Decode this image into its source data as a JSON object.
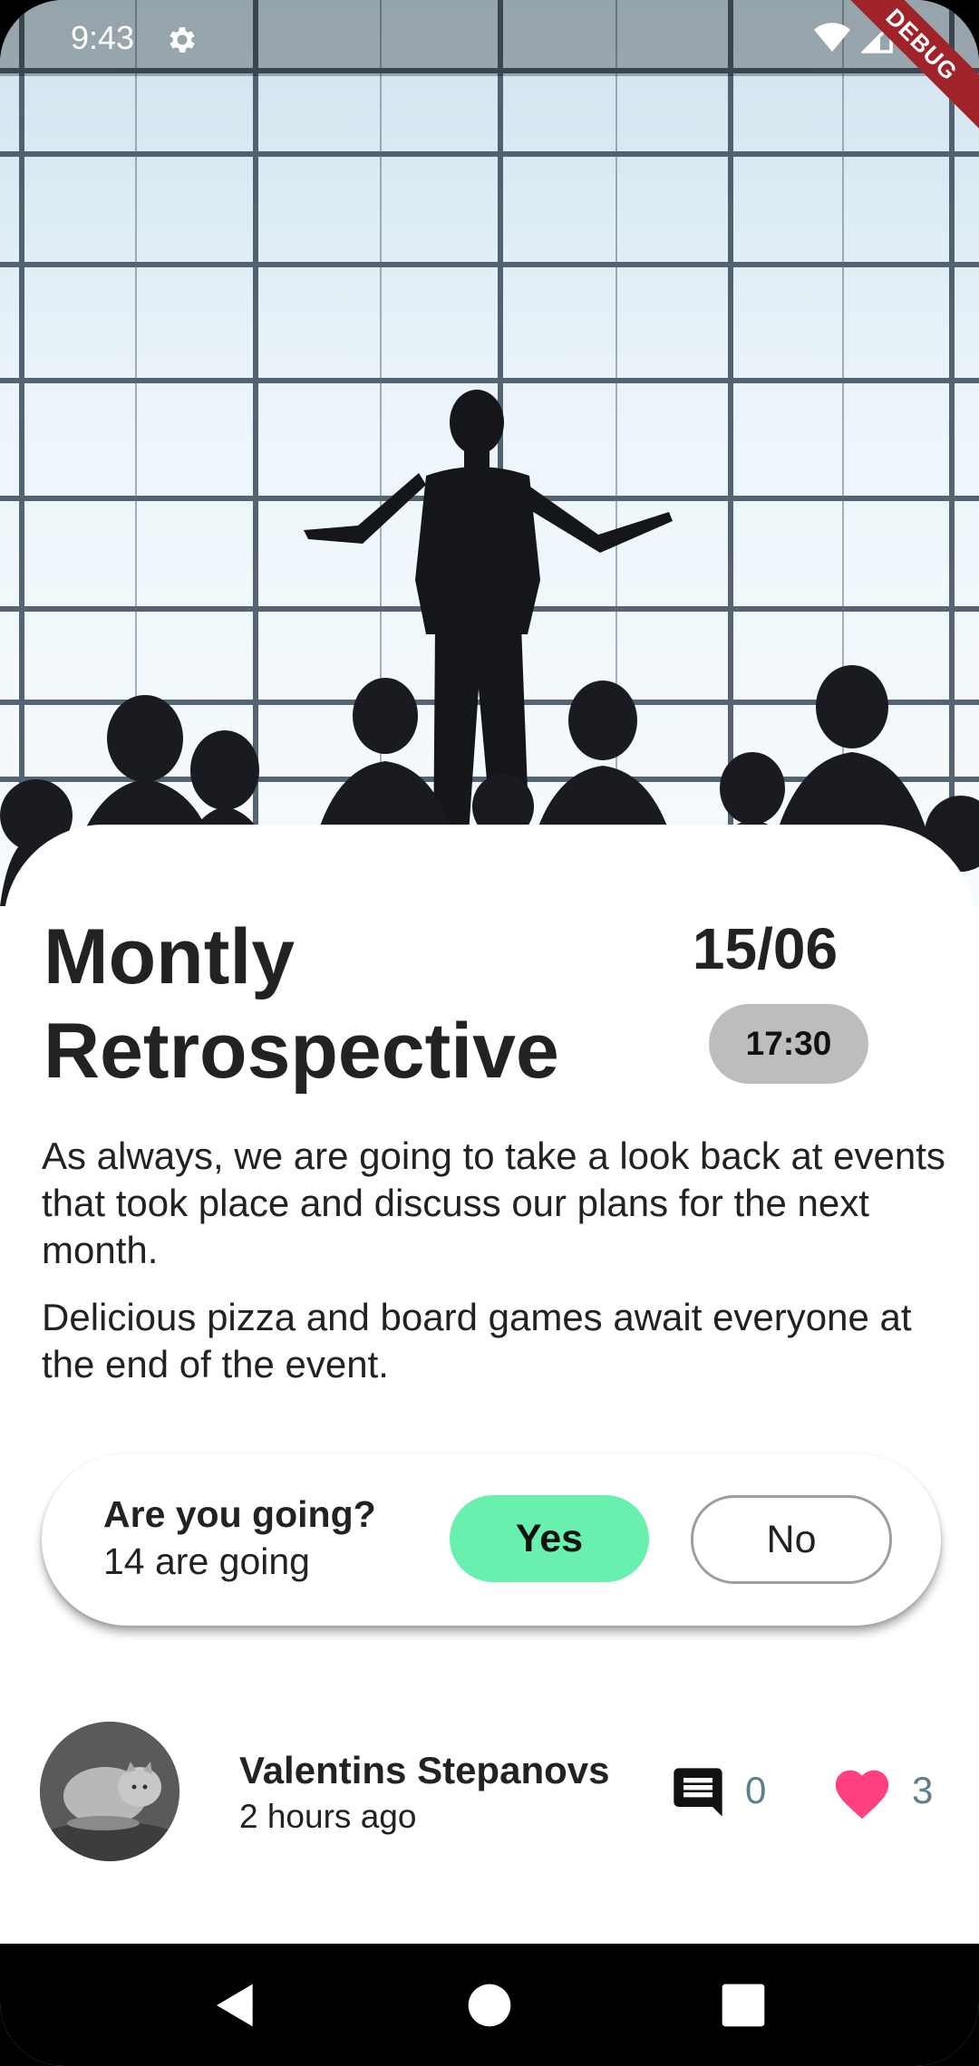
{
  "status_bar": {
    "time": "9:43",
    "debug_label": "DEBUG"
  },
  "event": {
    "title": "Montly Retrospective",
    "date": "15/06",
    "time": "17:30",
    "description": [
      "As always, we are going to take a look back at events that took place and discuss our plans for the next month.",
      "Delicious pizza and board games await everyone at the end of the event."
    ]
  },
  "rsvp": {
    "question": "Are you going?",
    "count_text": "14 are going",
    "yes_label": "Yes",
    "no_label": "No",
    "selected": "Yes",
    "accent": "#69f0ae"
  },
  "author": {
    "name": "Valentins Stepanovs",
    "posted": "2 hours ago",
    "comments": "0",
    "likes": "3"
  },
  "colors": {
    "heart": "#ff4081",
    "count_text": "#607d8b",
    "time_badge": "#bdbdbd"
  },
  "icons": {
    "status": [
      "gear-icon",
      "wifi-icon",
      "signal-icon",
      "battery-icon"
    ],
    "author_row": [
      "comment-icon",
      "heart-icon"
    ],
    "nav": [
      "back-icon",
      "home-icon",
      "recents-icon"
    ]
  }
}
